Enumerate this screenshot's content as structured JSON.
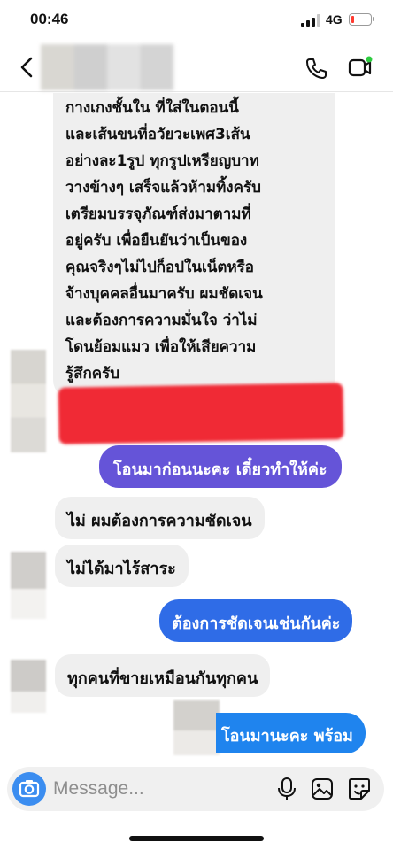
{
  "status_bar": {
    "time": "00:46",
    "network": "4G",
    "signal_icon": "cellular-signal-icon",
    "battery_icon": "battery-low-icon"
  },
  "nav": {
    "back_icon": "chevron-left-icon",
    "call_icon": "phone-icon",
    "video_icon": "video-camera-icon"
  },
  "messages": {
    "long_incoming": "กางเกงชั้นใน ที่ใส่ในตอนนี้\nและเส้นขนที่อวัยวะเพศ3เส้น\nอย่างละ1รูป ทุกรูปเหรียญบาท\nวางข้างๆ เสร็จแล้วห้ามทิ้งครับ\nเตรียมบรรจุภัณฑ์ส่งมาตามที่\nอยู่ครับ เพื่อยืนยันว่าเป็นของ\nคุณจริงๆไม่ไปก็อปในเน็ตหรือ\nจ้างบุคคลอื่นมาครับ ผมชัดเจน\nและต้องการความมั่นใจ ว่าไม่\nโดนย้อมแมว เพื่อให้เสียความ\nรู้สึกครับ",
    "out_1": "โอนมาก่อนนะคะ เดี๋ยวทำให้ค่ะ",
    "in_1": "ไม่ ผมต้องการความชัดเจน",
    "in_2": "ไม่ได้มาไร้สาระ",
    "out_2": "ต้องการชัดเจนเช่นกันค่ะ",
    "in_3": "ทุกคนที่ขายเหมือนกันทุกคน",
    "out_3": "โอนมานะคะ พร้อม"
  },
  "composer": {
    "placeholder": "Message...",
    "camera_icon": "camera-icon",
    "mic_icon": "microphone-icon",
    "gallery_icon": "image-icon",
    "sticker_icon": "sticker-icon"
  },
  "colors": {
    "outgoing_purple": "#6554d8",
    "outgoing_blue": "#2f6ce7",
    "outgoing_light_blue": "#1f84ee",
    "incoming_gray": "#efefef",
    "redaction_red": "#f02a35"
  }
}
